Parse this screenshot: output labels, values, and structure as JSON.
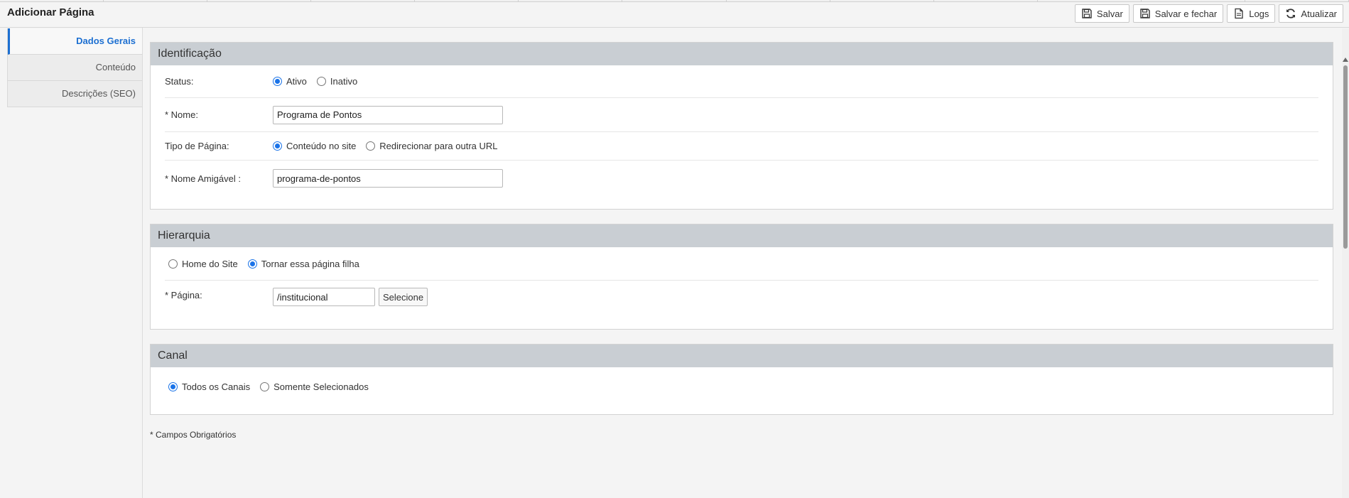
{
  "header": {
    "title": "Adicionar Página",
    "buttons": {
      "save": "Salvar",
      "save_close": "Salvar e fechar",
      "logs": "Logs",
      "refresh": "Atualizar"
    }
  },
  "sidebar": {
    "items": [
      {
        "label": "Dados Gerais",
        "active": true
      },
      {
        "label": "Conteúdo",
        "active": false
      },
      {
        "label": "Descrições (SEO)",
        "active": false
      }
    ]
  },
  "identificacao": {
    "title": "Identificação",
    "status": {
      "label": "Status:",
      "options": [
        "Ativo",
        "Inativo"
      ],
      "selected": "Ativo"
    },
    "nome": {
      "label": "* Nome:",
      "value": "Programa de Pontos"
    },
    "tipo": {
      "label": "Tipo de Página:",
      "options": [
        "Conteúdo no site",
        "Redirecionar para outra URL"
      ],
      "selected": "Conteúdo no site"
    },
    "nome_amigavel": {
      "label": "* Nome Amigável :",
      "value": "programa-de-pontos"
    }
  },
  "hierarquia": {
    "title": "Hierarquia",
    "options": [
      "Home do Site",
      "Tornar essa página filha"
    ],
    "selected": "Tornar essa página filha",
    "pagina": {
      "label": "* Página:",
      "value": "/institucional",
      "button": "Selecione"
    }
  },
  "canal": {
    "title": "Canal",
    "options": [
      "Todos os Canais",
      "Somente Selecionados"
    ],
    "selected": "Todos os Canais"
  },
  "footer": {
    "required_note": "* Campos Obrigatórios"
  },
  "colors": {
    "accent": "#1c6fd1",
    "section_header": "#c9ced3"
  }
}
